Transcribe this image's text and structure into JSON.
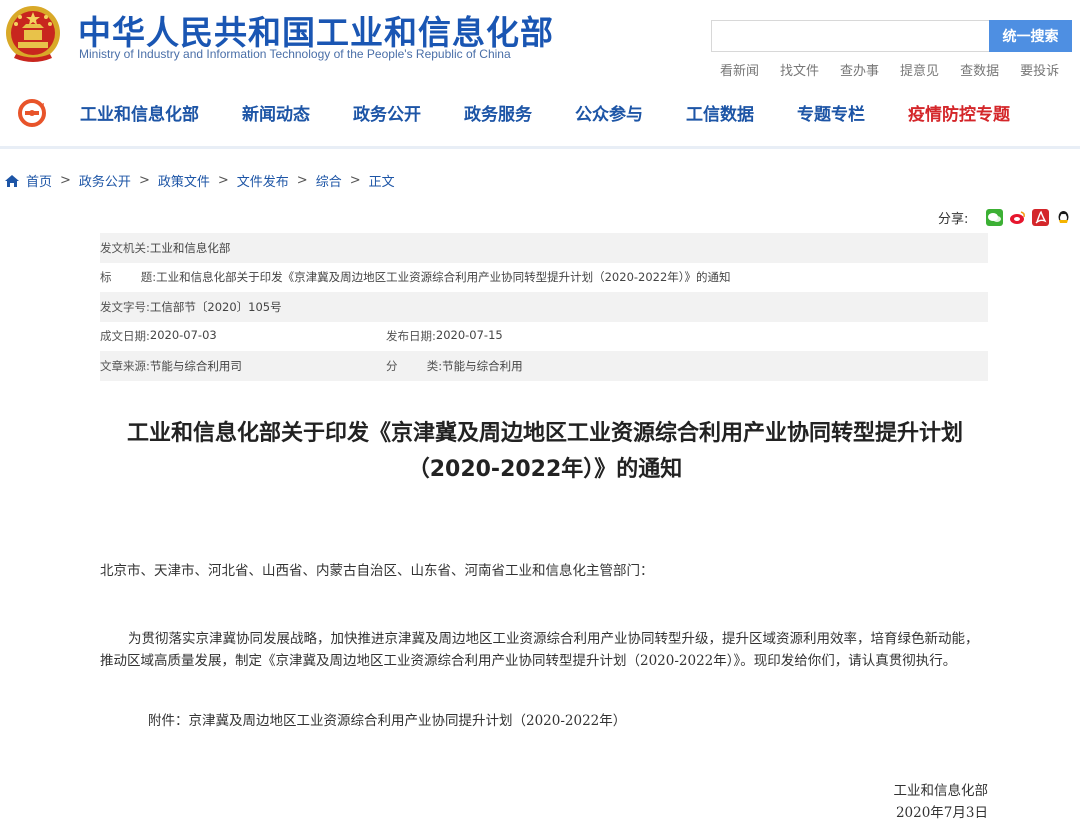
{
  "header": {
    "title": "中华人民共和国工业和信息化部",
    "subtitle": "Ministry of Industry and Information Technology of the People's Republic of China",
    "search_placeholder": "",
    "search_button": "统一搜索",
    "quick_links": [
      "看新闻",
      "找文件",
      "查办事",
      "提意见",
      "查数据",
      "要投诉"
    ]
  },
  "nav": {
    "items": [
      "工业和信息化部",
      "新闻动态",
      "政务公开",
      "政务服务",
      "公众参与",
      "工信数据",
      "专题专栏",
      "疫情防控专题"
    ],
    "highlight_color": "#d4262a"
  },
  "breadcrumb": {
    "items": [
      "首页",
      "政务公开",
      "政策文件",
      "文件发布",
      "综合",
      "正文"
    ]
  },
  "share": {
    "label": "分享:",
    "icons": [
      "wechat-icon",
      "weibo-icon",
      "pdf-icon",
      "qq-icon"
    ]
  },
  "meta": {
    "issuer_label": "发文机关:",
    "issuer": "工业和信息化部",
    "title_label": "标        题:",
    "title": "工业和信息化部关于印发《京津冀及周边地区工业资源综合利用产业协同转型提升计划（2020-2022年）》的通知",
    "doc_no_label": "发文字号:",
    "doc_no": "工信部节〔2020〕105号",
    "created_label": "成文日期:",
    "created": "2020-07-03",
    "published_label": "发布日期:",
    "published": "2020-07-15",
    "source_label": "文章来源:",
    "source": "节能与综合利用司",
    "category_label": "分        类:",
    "category": "节能与综合利用"
  },
  "article": {
    "title": "工业和信息化部关于印发《京津冀及周边地区工业资源综合利用产业协同转型提升计划（2020-2022年）》的通知",
    "addressee": "北京市、天津市、河北省、山西省、内蒙古自治区、山东省、河南省工业和信息化主管部门：",
    "paragraph": "为贯彻落实京津冀协同发展战略，加快推进京津冀及周边地区工业资源综合利用产业协同转型升级，提升区域资源利用效率，培育绿色新动能，推动区域高质量发展，制定《京津冀及周边地区工业资源综合利用产业协同转型提升计划（2020-2022年）》。现印发给你们，请认真贯彻执行。",
    "attachment": "附件：京津冀及周边地区工业资源综合利用产业协同提升计划（2020-2022年）",
    "signer": "工业和信息化部",
    "date": "2020年7月3日"
  }
}
